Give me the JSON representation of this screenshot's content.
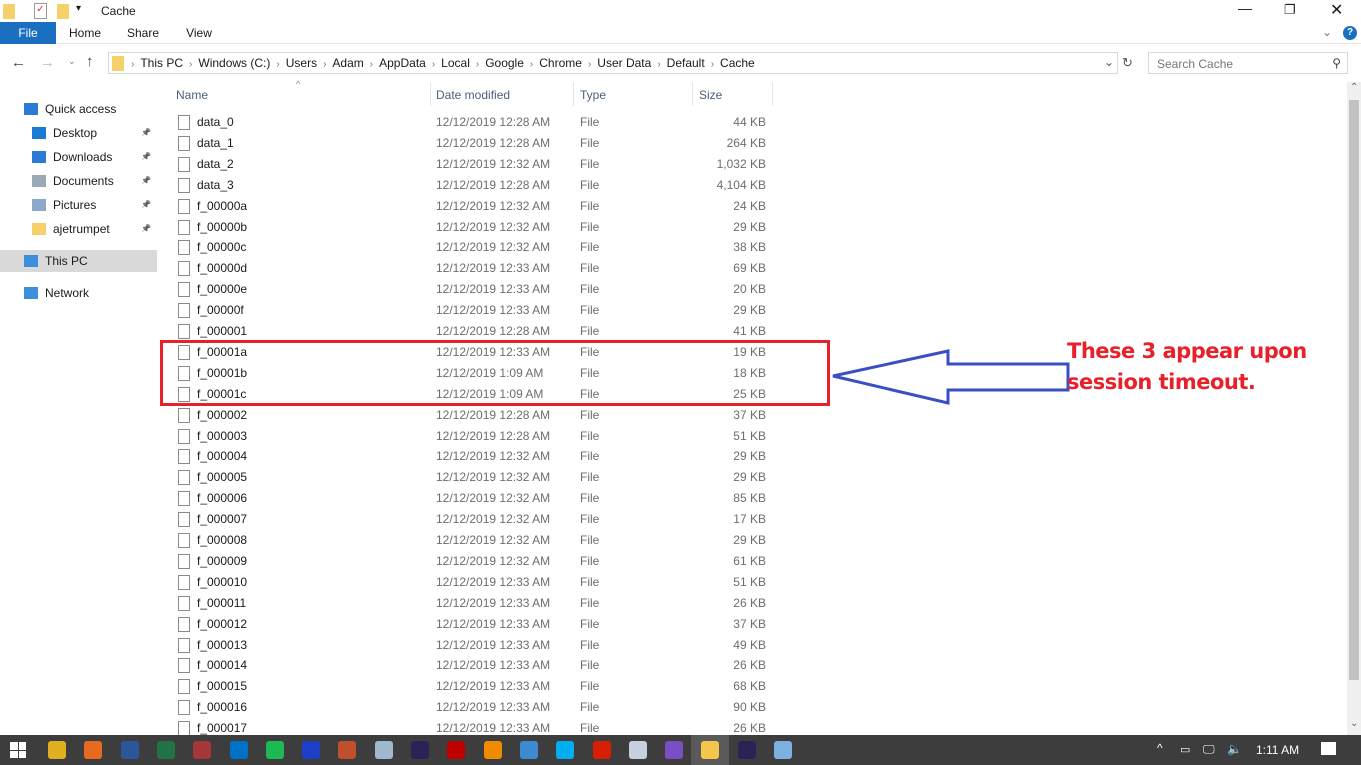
{
  "window": {
    "title": "Cache"
  },
  "ribbon": {
    "tabs": [
      "File",
      "Home",
      "Share",
      "View"
    ]
  },
  "address": {
    "crumbs": [
      "This PC",
      "Windows (C:)",
      "Users",
      "Adam",
      "AppData",
      "Local",
      "Google",
      "Chrome",
      "User Data",
      "Default",
      "Cache"
    ]
  },
  "search": {
    "placeholder": "Search Cache"
  },
  "sidebar": {
    "items": [
      {
        "label": "Quick access",
        "icon": "star-icon"
      },
      {
        "label": "Desktop",
        "icon": "desktop-icon",
        "pinned": true
      },
      {
        "label": "Downloads",
        "icon": "download-icon",
        "pinned": true
      },
      {
        "label": "Documents",
        "icon": "documents-icon",
        "pinned": true
      },
      {
        "label": "Pictures",
        "icon": "pictures-icon",
        "pinned": true
      },
      {
        "label": "ajetrumpet",
        "icon": "folder-icon",
        "pinned": true
      },
      {
        "label": "This PC",
        "icon": "computer-icon",
        "selected": true
      },
      {
        "label": "Network",
        "icon": "network-icon"
      }
    ]
  },
  "columns": {
    "name": "Name",
    "date": "Date modified",
    "type": "Type",
    "size": "Size"
  },
  "files": [
    [
      "data_0",
      "12/12/2019 12:28 AM",
      "File",
      "44 KB"
    ],
    [
      "data_1",
      "12/12/2019 12:28 AM",
      "File",
      "264 KB"
    ],
    [
      "data_2",
      "12/12/2019 12:32 AM",
      "File",
      "1,032 KB"
    ],
    [
      "data_3",
      "12/12/2019 12:28 AM",
      "File",
      "4,104 KB"
    ],
    [
      "f_00000a",
      "12/12/2019 12:32 AM",
      "File",
      "24 KB"
    ],
    [
      "f_00000b",
      "12/12/2019 12:32 AM",
      "File",
      "29 KB"
    ],
    [
      "f_00000c",
      "12/12/2019 12:32 AM",
      "File",
      "38 KB"
    ],
    [
      "f_00000d",
      "12/12/2019 12:33 AM",
      "File",
      "69 KB"
    ],
    [
      "f_00000e",
      "12/12/2019 12:33 AM",
      "File",
      "20 KB"
    ],
    [
      "f_00000f",
      "12/12/2019 12:33 AM",
      "File",
      "29 KB"
    ],
    [
      "f_000001",
      "12/12/2019 12:28 AM",
      "File",
      "41 KB"
    ],
    [
      "f_00001a",
      "12/12/2019 12:33 AM",
      "File",
      "19 KB"
    ],
    [
      "f_00001b",
      "12/12/2019 1:09 AM",
      "File",
      "18 KB"
    ],
    [
      "f_00001c",
      "12/12/2019 1:09 AM",
      "File",
      "25 KB"
    ],
    [
      "f_000002",
      "12/12/2019 12:28 AM",
      "File",
      "37 KB"
    ],
    [
      "f_000003",
      "12/12/2019 12:28 AM",
      "File",
      "51 KB"
    ],
    [
      "f_000004",
      "12/12/2019 12:32 AM",
      "File",
      "29 KB"
    ],
    [
      "f_000005",
      "12/12/2019 12:32 AM",
      "File",
      "29 KB"
    ],
    [
      "f_000006",
      "12/12/2019 12:32 AM",
      "File",
      "85 KB"
    ],
    [
      "f_000007",
      "12/12/2019 12:32 AM",
      "File",
      "17 KB"
    ],
    [
      "f_000008",
      "12/12/2019 12:32 AM",
      "File",
      "29 KB"
    ],
    [
      "f_000009",
      "12/12/2019 12:32 AM",
      "File",
      "61 KB"
    ],
    [
      "f_000010",
      "12/12/2019 12:33 AM",
      "File",
      "51 KB"
    ],
    [
      "f_000011",
      "12/12/2019 12:33 AM",
      "File",
      "26 KB"
    ],
    [
      "f_000012",
      "12/12/2019 12:33 AM",
      "File",
      "37 KB"
    ],
    [
      "f_000013",
      "12/12/2019 12:33 AM",
      "File",
      "49 KB"
    ],
    [
      "f_000014",
      "12/12/2019 12:33 AM",
      "File",
      "26 KB"
    ],
    [
      "f_000015",
      "12/12/2019 12:33 AM",
      "File",
      "68 KB"
    ],
    [
      "f_000016",
      "12/12/2019 12:33 AM",
      "File",
      "90 KB"
    ],
    [
      "f_000017",
      "12/12/2019 12:33 AM",
      "File",
      "26 KB"
    ]
  ],
  "annotation": {
    "line1": "These 3 appear upon",
    "line2": "session timeout.",
    "color": "#e8202a",
    "arrow_color": "#3a4fc4"
  },
  "taskbar": {
    "apps": [
      {
        "name": "chrome",
        "color": "#e0b020"
      },
      {
        "name": "firefox",
        "color": "#e66a1f"
      },
      {
        "name": "word",
        "color": "#2b579a"
      },
      {
        "name": "excel",
        "color": "#217346"
      },
      {
        "name": "access",
        "color": "#a4373a"
      },
      {
        "name": "outlook",
        "color": "#0072c6"
      },
      {
        "name": "spotify",
        "color": "#1db954"
      },
      {
        "name": "malwarebytes",
        "color": "#1e3fc8"
      },
      {
        "name": "paint-brush",
        "color": "#c0502c"
      },
      {
        "name": "notepad",
        "color": "#9fb8d0"
      },
      {
        "name": "eclipse",
        "color": "#2c2255"
      },
      {
        "name": "filezilla",
        "color": "#bf0000"
      },
      {
        "name": "vlc",
        "color": "#f08a00"
      },
      {
        "name": "app-blue",
        "color": "#3d8ad0"
      },
      {
        "name": "skype",
        "color": "#00aff0"
      },
      {
        "name": "acrobat",
        "color": "#d81e05"
      },
      {
        "name": "notepad-plus",
        "color": "#c8d0e0"
      },
      {
        "name": "visual-studio",
        "color": "#7a4fc4"
      },
      {
        "name": "file-explorer",
        "color": "#f4c64a"
      },
      {
        "name": "eclipse-2",
        "color": "#2c2255"
      },
      {
        "name": "paint",
        "color": "#7cb0e0"
      }
    ],
    "time": "1:11 AM"
  }
}
